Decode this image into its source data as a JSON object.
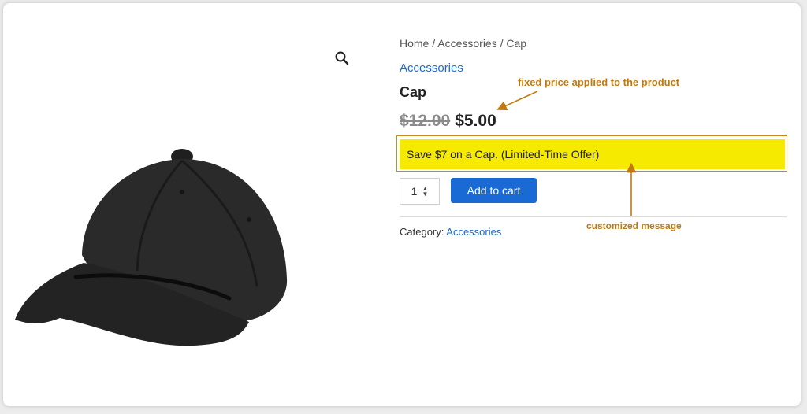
{
  "breadcrumb": "Home / Accessories / Cap",
  "category_link": "Accessories",
  "product": {
    "title": "Cap",
    "price_old": "$12.00",
    "price_new": "$5.00"
  },
  "message": "Save $7 on a Cap. (Limited-Time Offer)",
  "quantity": "1",
  "add_to_cart_label": "Add to cart",
  "category_meta": {
    "label": "Category:",
    "value": "Accessories"
  },
  "annotations": {
    "price": "fixed price applied to the product",
    "message": "customized message"
  },
  "icons": {
    "zoom": "search-icon"
  },
  "colors": {
    "accent": "#1a6ad6",
    "highlight": "#f6ea00",
    "annotation": "#c07a10"
  }
}
